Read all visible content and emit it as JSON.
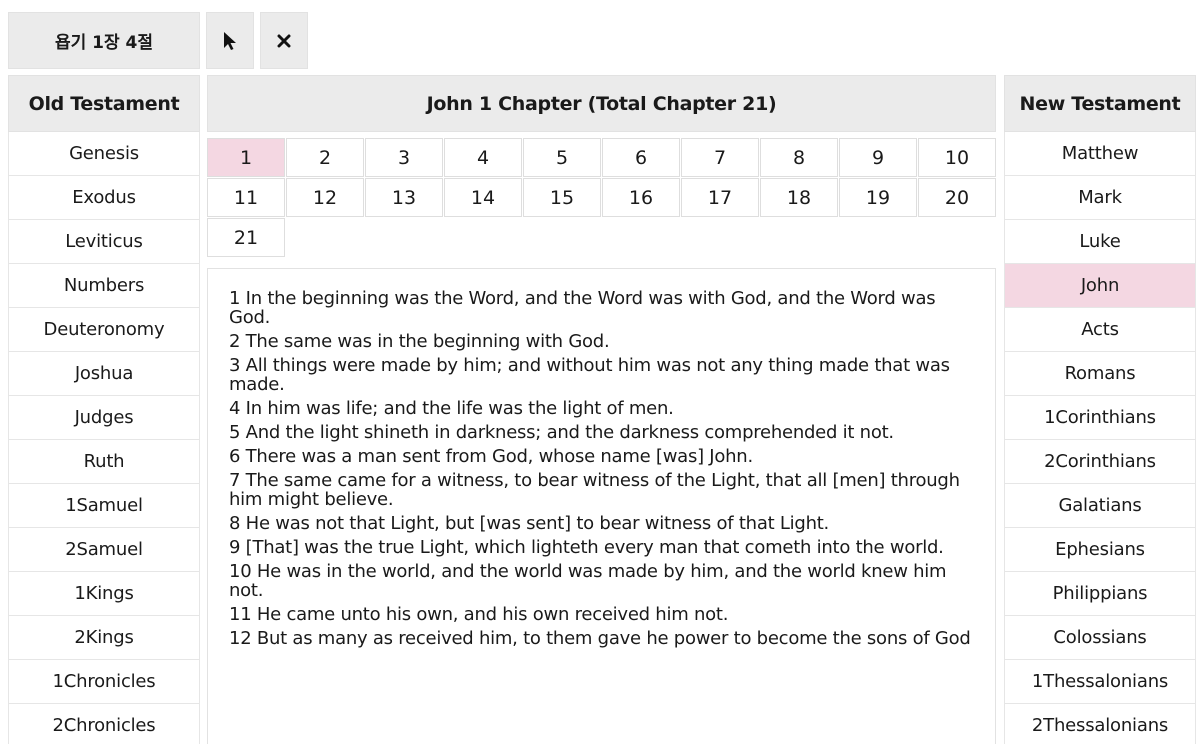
{
  "toolbar": {
    "current_verse": "욥기 1장 4절",
    "pointer_icon": "cursor-arrow-icon",
    "close_icon": "close-x-icon"
  },
  "left": {
    "header": "Old Testament",
    "books": [
      "Genesis",
      "Exodus",
      "Leviticus",
      "Numbers",
      "Deuteronomy",
      "Joshua",
      "Judges",
      "Ruth",
      "1Samuel",
      "2Samuel",
      "1Kings",
      "2Kings",
      "1Chronicles",
      "2Chronicles"
    ]
  },
  "right": {
    "header": "New Testament",
    "selected": "John",
    "books": [
      "Matthew",
      "Mark",
      "Luke",
      "John",
      "Acts",
      "Romans",
      "1Corinthians",
      "2Corinthians",
      "Galatians",
      "Ephesians",
      "Philippians",
      "Colossians",
      "1Thessalonians",
      "2Thessalonians"
    ]
  },
  "main": {
    "header": "John 1 Chapter (Total Chapter 21)",
    "selected_chapter": "1",
    "chapters": [
      "1",
      "2",
      "3",
      "4",
      "5",
      "6",
      "7",
      "8",
      "9",
      "10",
      "11",
      "12",
      "13",
      "14",
      "15",
      "16",
      "17",
      "18",
      "19",
      "20",
      "21"
    ],
    "verses": [
      "1 In the beginning was the Word, and the Word was with God, and the Word was God.",
      "2 The same was in the beginning with God.",
      "3 All things were made by him; and without him was not any thing made that was made.",
      "4 In him was life; and the life was the light of men.",
      "5 And the light shineth in darkness; and the darkness comprehended it not.",
      "6 There was a man sent from God, whose name [was] John.",
      "7 The same came for a witness, to bear witness of the Light, that all [men] through him might believe.",
      "8 He was not that Light, but [was sent] to bear witness of that Light.",
      "9 [That] was the true Light, which lighteth every man that cometh into the world.",
      "10 He was in the world, and the world was made by him, and the world knew him not.",
      "11 He came unto his own, and his own received him not.",
      "12 But as many as received him, to them gave he power to become the sons of God"
    ]
  },
  "colors": {
    "selected": "#f4d7e2",
    "header_bg": "#ebebeb"
  }
}
